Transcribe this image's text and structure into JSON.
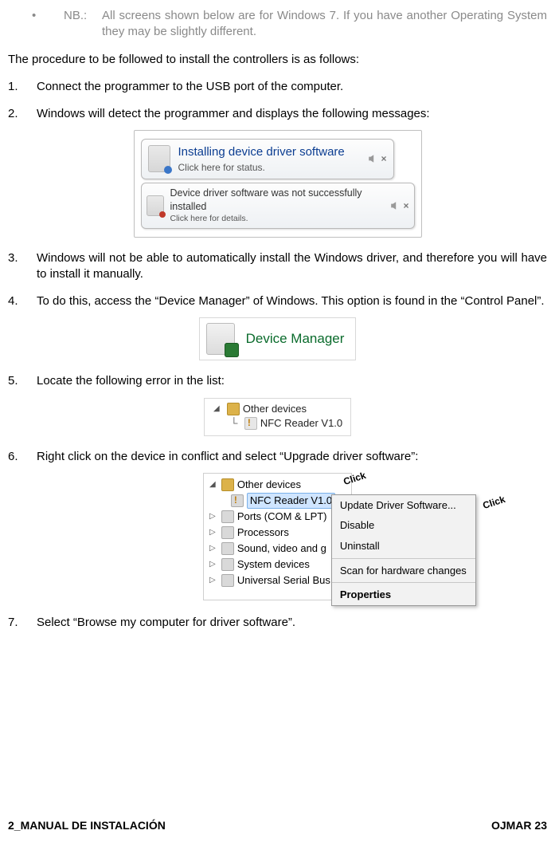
{
  "note": {
    "bullet": "•",
    "label": "NB.:",
    "text": "All screens shown below are for Windows 7. If you have another Operating System they may be slightly different."
  },
  "intro": "The procedure to be followed to install the controllers is as follows:",
  "steps": [
    "Connect the programmer to the USB port of the computer.",
    "Windows will detect the programmer and displays the following messages:",
    "Windows will not be able to automatically install the Windows driver, and therefore you will have to install it manually.",
    "To do this, access the “Device Manager” of Windows. This option is found in the “Control Panel”.",
    "Locate the following error in the list:",
    "Right click on the device in conflict and select “Upgrade driver software”:",
    "Select “Browse my computer for driver software”."
  ],
  "fig1": {
    "b1_title": "Installing device driver software",
    "b1_sub": "Click here for status.",
    "b2_title": "Device driver software was not successfully installed",
    "b2_sub": "Click here for details."
  },
  "fig2": {
    "label": "Device Manager"
  },
  "fig3": {
    "parent": "Other devices",
    "child": "NFC Reader V1.0"
  },
  "fig4": {
    "tree": {
      "other": "Other devices",
      "nfc": "NFC Reader V1.0",
      "ports": "Ports (COM & LPT)",
      "proc": "Processors",
      "sound": "Sound, video and g",
      "sys": "System devices",
      "usb": "Universal Serial Bus"
    },
    "menu": {
      "update": "Update Driver Software...",
      "disable": "Disable",
      "uninstall": "Uninstall",
      "scan": "Scan for hardware changes",
      "props": "Properties"
    },
    "click1": "Click",
    "click2": "Click"
  },
  "footer": {
    "left": "2_MANUAL DE INSTALACIÓN",
    "right": "OJMAR 23"
  }
}
